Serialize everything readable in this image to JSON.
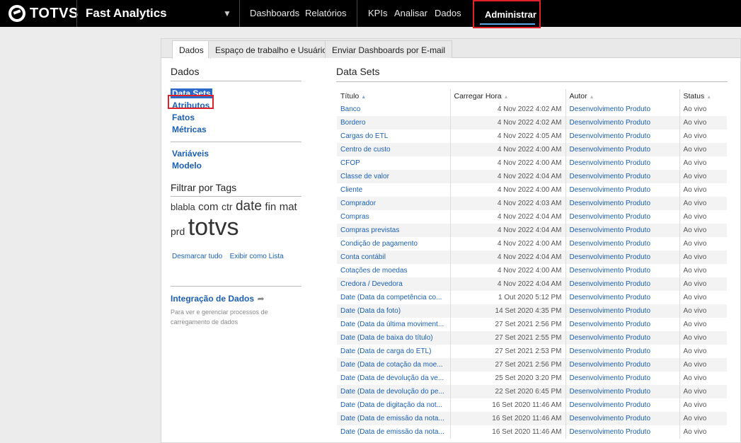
{
  "topbar": {
    "logo": "TOTVS",
    "app_title": "Fast Analytics",
    "dropdown_icon": "chevron-down-icon",
    "nav": [
      "Dashboards",
      "Relatórios",
      "KPIs",
      "Analisar",
      "Dados"
    ],
    "active": "Administrar"
  },
  "tabs": [
    "Dados",
    "Espaço de trabalho e Usuários",
    "Enviar Dashboards por E-mail"
  ],
  "left": {
    "heading": "Dados",
    "links": [
      "Data Sets",
      "Atributos",
      "Fatos",
      "Métricas"
    ],
    "links2": [
      "Variáveis",
      "Modelo"
    ],
    "tags_heading": "Filtrar por Tags",
    "tags": [
      "blabla",
      "com",
      "ctr",
      "date",
      "fin",
      "mat",
      "prd",
      "totvs"
    ],
    "unmark_all": "Desmarcar tudo",
    "show_list": "Exibir como Lista",
    "integration_title": "Integração de Dados",
    "integration_note": "Para ver e gerenciar processos de carregamento de dados"
  },
  "datasets": {
    "heading": "Data Sets",
    "columns": [
      "Título",
      "Carregar Hora",
      "Autor",
      "Status"
    ],
    "rows": [
      [
        "Banco",
        "4 Nov 2022 4:02 AM",
        "Desenvolvimento Produto",
        "Ao vivo"
      ],
      [
        "Bordero",
        "4 Nov 2022 4:02 AM",
        "Desenvolvimento Produto",
        "Ao vivo"
      ],
      [
        "Cargas do ETL",
        "4 Nov 2022 4:05 AM",
        "Desenvolvimento Produto",
        "Ao vivo"
      ],
      [
        "Centro de custo",
        "4 Nov 2022 4:00 AM",
        "Desenvolvimento Produto",
        "Ao vivo"
      ],
      [
        "CFOP",
        "4 Nov 2022 4:00 AM",
        "Desenvolvimento Produto",
        "Ao vivo"
      ],
      [
        "Classe de valor",
        "4 Nov 2022 4:04 AM",
        "Desenvolvimento Produto",
        "Ao vivo"
      ],
      [
        "Cliente",
        "4 Nov 2022 4:00 AM",
        "Desenvolvimento Produto",
        "Ao vivo"
      ],
      [
        "Comprador",
        "4 Nov 2022 4:03 AM",
        "Desenvolvimento Produto",
        "Ao vivo"
      ],
      [
        "Compras",
        "4 Nov 2022 4:04 AM",
        "Desenvolvimento Produto",
        "Ao vivo"
      ],
      [
        "Compras previstas",
        "4 Nov 2022 4:04 AM",
        "Desenvolvimento Produto",
        "Ao vivo"
      ],
      [
        "Condição de pagamento",
        "4 Nov 2022 4:00 AM",
        "Desenvolvimento Produto",
        "Ao vivo"
      ],
      [
        "Conta contábil",
        "4 Nov 2022 4:04 AM",
        "Desenvolvimento Produto",
        "Ao vivo"
      ],
      [
        "Cotações de moedas",
        "4 Nov 2022 4:00 AM",
        "Desenvolvimento Produto",
        "Ao vivo"
      ],
      [
        "Credora / Devedora",
        "4 Nov 2022 4:04 AM",
        "Desenvolvimento Produto",
        "Ao vivo"
      ],
      [
        "Date (Data da competência co...",
        "1 Out 2020 5:12 PM",
        "Desenvolvimento Produto",
        "Ao vivo"
      ],
      [
        "Date (Data da foto)",
        "14 Set 2020 4:35 PM",
        "Desenvolvimento Produto",
        "Ao vivo"
      ],
      [
        "Date (Data da última moviment...",
        "27 Set 2021 2:56 PM",
        "Desenvolvimento Produto",
        "Ao vivo"
      ],
      [
        "Date (Data de baixa do título)",
        "27 Set 2021 2:55 PM",
        "Desenvolvimento Produto",
        "Ao vivo"
      ],
      [
        "Date (Data de carga do ETL)",
        "27 Set 2021 2:53 PM",
        "Desenvolvimento Produto",
        "Ao vivo"
      ],
      [
        "Date (Data de cotação da moe...",
        "27 Set 2021 2:56 PM",
        "Desenvolvimento Produto",
        "Ao vivo"
      ],
      [
        "Date (Data de devolução da ve...",
        "25 Set 2020 3:20 PM",
        "Desenvolvimento Produto",
        "Ao vivo"
      ],
      [
        "Date (Data de devolução do pe...",
        "22 Set 2020 6:45 PM",
        "Desenvolvimento Produto",
        "Ao vivo"
      ],
      [
        "Date (Data de digitação da not...",
        "16 Set 2020 11:46 AM",
        "Desenvolvimento Produto",
        "Ao vivo"
      ],
      [
        "Date (Data de emissão da nota...",
        "16 Set 2020 11:46 AM",
        "Desenvolvimento Produto",
        "Ao vivo"
      ],
      [
        "Date (Data de emissão da nota...",
        "16 Set 2020 11:46 AM",
        "Desenvolvimento Produto",
        "Ao vivo"
      ]
    ]
  }
}
